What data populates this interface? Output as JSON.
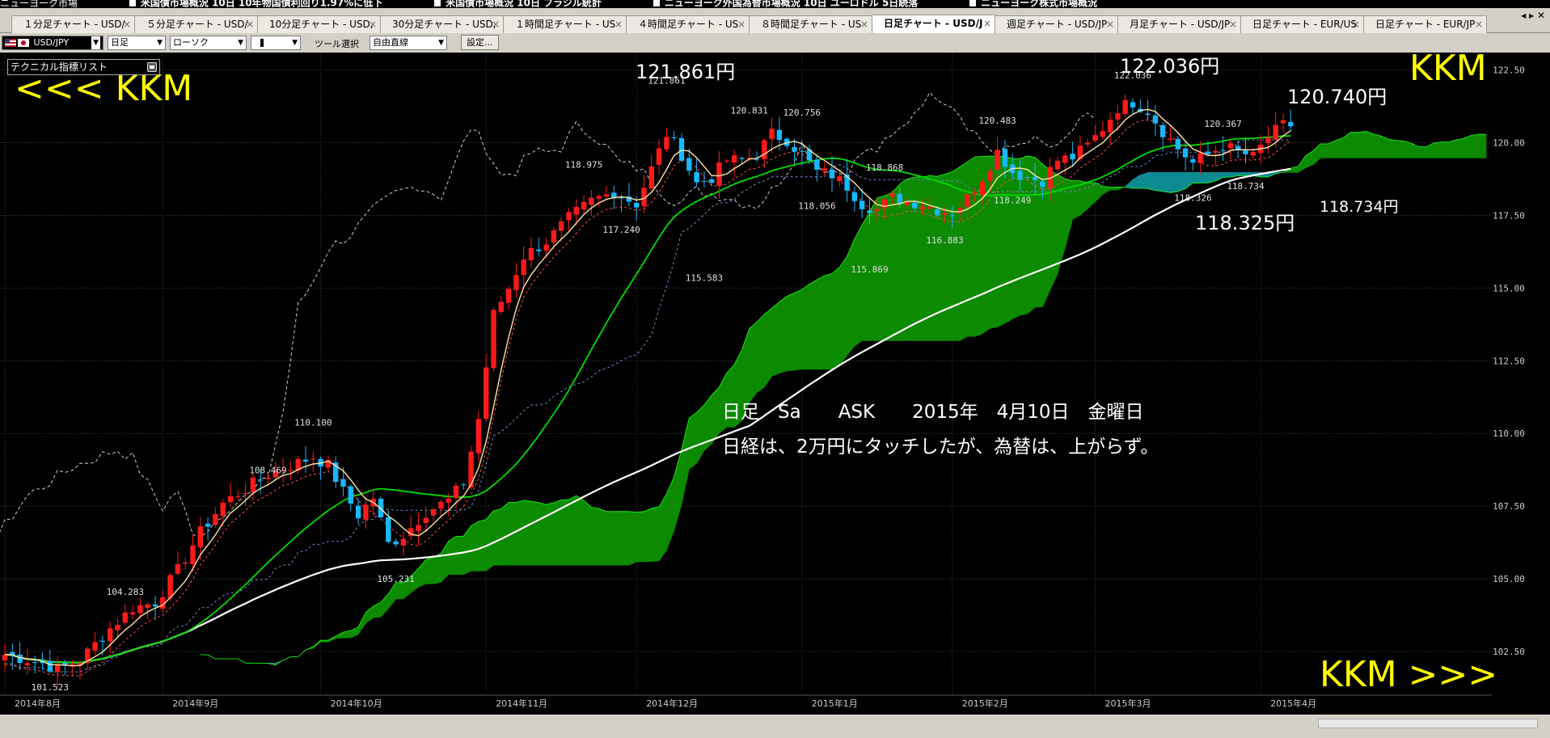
{
  "news_ticker": [
    "ニューヨーク市場",
    "米国債市場概況 10日 10年物国債利回り1.97%に低下",
    "米国債市場概況 10日 ブラジル統計",
    "ニューヨーク外国為替市場概況 10日 ユーロドル 5日続落",
    "ニューヨーク株式市場概況"
  ],
  "tabs": [
    {
      "label": "１分足チャート - USD/"
    },
    {
      "label": "５分足チャート - USD/"
    },
    {
      "label": "10分足チャート - USD,"
    },
    {
      "label": "30分足チャート - USD,"
    },
    {
      "label": "１時間足チャート - US"
    },
    {
      "label": "４時間足チャート - US"
    },
    {
      "label": "８時間足チャート - US"
    },
    {
      "label": "日足チャート - USD/J",
      "active": true
    },
    {
      "label": "週足チャート - USD/JP"
    },
    {
      "label": "月足チャート - USD/JP"
    },
    {
      "label": "日足チャート - EUR/US"
    },
    {
      "label": "日足チャート - EUR/JP"
    }
  ],
  "tab_controls": "◂ ▸ ✕",
  "toolbar": {
    "pair": "USD/JPY",
    "period": "日足",
    "chart_type": "ローソク",
    "tool_label": "ツール選択",
    "tool_value": "自由直線",
    "settings_button": "設定..."
  },
  "tech_list_label": "テクニカル指標リスト",
  "chart_data": {
    "type": "candlestick",
    "ylim": [
      101.0,
      123.1
    ],
    "y_ticks": [
      122.5,
      120.0,
      117.5,
      115.0,
      112.5,
      110.0,
      107.5,
      105.0,
      102.5
    ],
    "y_tick_labels": [
      "122.50",
      "120.00",
      "117.50",
      "115.00",
      "112.50",
      "110.00",
      "107.50",
      "105.00",
      "102.50"
    ],
    "x_labels": [
      {
        "label": "2014年8月",
        "index": 0
      },
      {
        "label": "2014年9月",
        "index": 21
      },
      {
        "label": "2014年10月",
        "index": 42
      },
      {
        "label": "2014年11月",
        "index": 64
      },
      {
        "label": "2014年12月",
        "index": 84
      },
      {
        "label": "2015年1月",
        "index": 106
      },
      {
        "label": "2015年2月",
        "index": 126
      },
      {
        "label": "2015年3月",
        "index": 145
      },
      {
        "label": "2015年4月",
        "index": 167
      }
    ],
    "price_labels": [
      {
        "text": "101.523",
        "index": 6,
        "value": 101.5,
        "pos": "below"
      },
      {
        "text": "104.283",
        "index": 16,
        "value": 104.28,
        "pos": "above"
      },
      {
        "text": "108.469",
        "index": 35,
        "value": 108.47,
        "pos": "above"
      },
      {
        "text": "110.100",
        "index": 41,
        "value": 110.1,
        "pos": "above"
      },
      {
        "text": "105.231",
        "index": 52,
        "value": 105.23,
        "pos": "below"
      },
      {
        "text": "118.975",
        "index": 77,
        "value": 118.97,
        "pos": "above"
      },
      {
        "text": "117.240",
        "index": 82,
        "value": 117.24,
        "pos": "below"
      },
      {
        "text": "121.861",
        "index": 88,
        "value": 121.86,
        "pos": "above"
      },
      {
        "text": "115.583",
        "index": 93,
        "value": 115.58,
        "pos": "below"
      },
      {
        "text": "120.831",
        "index": 99,
        "value": 120.83,
        "pos": "above"
      },
      {
        "text": "120.756",
        "index": 106,
        "value": 120.76,
        "pos": "above"
      },
      {
        "text": "118.056",
        "index": 108,
        "value": 118.06,
        "pos": "below"
      },
      {
        "text": "118.868",
        "index": 117,
        "value": 118.87,
        "pos": "above"
      },
      {
        "text": "115.869",
        "index": 115,
        "value": 115.87,
        "pos": "below"
      },
      {
        "text": "116.883",
        "index": 125,
        "value": 116.88,
        "pos": "below"
      },
      {
        "text": "120.483",
        "index": 132,
        "value": 120.48,
        "pos": "above"
      },
      {
        "text": "118.249",
        "index": 134,
        "value": 118.25,
        "pos": "below"
      },
      {
        "text": "122.036",
        "index": 150,
        "value": 122.04,
        "pos": "above"
      },
      {
        "text": "120.367",
        "index": 162,
        "value": 120.37,
        "pos": "above"
      },
      {
        "text": "118.326",
        "index": 158,
        "value": 118.33,
        "pos": "below"
      },
      {
        "text": "118.734",
        "index": 165,
        "value": 118.73,
        "pos": "below"
      }
    ],
    "close_path": [
      [
        0,
        102.4
      ],
      [
        5,
        102.1
      ],
      [
        7,
        101.9
      ],
      [
        10,
        102.2
      ],
      [
        14,
        103.3
      ],
      [
        17,
        104.0
      ],
      [
        20,
        104.2
      ],
      [
        23,
        105.3
      ],
      [
        26,
        106.6
      ],
      [
        29,
        107.6
      ],
      [
        32,
        108.1
      ],
      [
        35,
        108.6
      ],
      [
        38,
        108.9
      ],
      [
        41,
        109.2
      ],
      [
        43,
        108.9
      ],
      [
        45,
        108.0
      ],
      [
        47,
        107.2
      ],
      [
        49,
        107.8
      ],
      [
        51,
        106.2
      ],
      [
        53,
        106.5
      ],
      [
        56,
        107.3
      ],
      [
        59,
        107.7
      ],
      [
        61,
        108.3
      ],
      [
        63,
        110.5
      ],
      [
        65,
        114.1
      ],
      [
        67,
        115.0
      ],
      [
        69,
        116.1
      ],
      [
        72,
        116.6
      ],
      [
        75,
        117.4
      ],
      [
        78,
        118.0
      ],
      [
        81,
        118.3
      ],
      [
        84,
        117.9
      ],
      [
        86,
        119.1
      ],
      [
        88,
        120.3
      ],
      [
        90,
        119.6
      ],
      [
        92,
        118.6
      ],
      [
        94,
        118.8
      ],
      [
        96,
        119.4
      ],
      [
        98,
        119.4
      ],
      [
        100,
        119.6
      ],
      [
        102,
        120.3
      ],
      [
        104,
        120.1
      ],
      [
        106,
        119.6
      ],
      [
        108,
        119.0
      ],
      [
        110,
        118.9
      ],
      [
        112,
        118.5
      ],
      [
        114,
        117.9
      ],
      [
        116,
        117.7
      ],
      [
        118,
        118.1
      ],
      [
        120,
        118.0
      ],
      [
        122,
        117.9
      ],
      [
        124,
        117.7
      ],
      [
        126,
        117.6
      ],
      [
        128,
        118.1
      ],
      [
        130,
        118.8
      ],
      [
        132,
        119.7
      ],
      [
        134,
        119.0
      ],
      [
        136,
        118.8
      ],
      [
        138,
        118.7
      ],
      [
        140,
        119.4
      ],
      [
        142,
        119.5
      ],
      [
        144,
        119.9
      ],
      [
        146,
        120.5
      ],
      [
        148,
        121.2
      ],
      [
        150,
        121.4
      ],
      [
        152,
        121.1
      ],
      [
        154,
        120.4
      ],
      [
        156,
        119.8
      ],
      [
        158,
        119.3
      ],
      [
        160,
        119.6
      ],
      [
        162,
        119.9
      ],
      [
        164,
        119.7
      ],
      [
        166,
        119.5
      ],
      [
        168,
        120.2
      ],
      [
        170,
        120.6
      ]
    ],
    "annotations": {
      "high_1": "121.861円",
      "high_2": "122.036円",
      "current": "120.740円",
      "low_1": "118.734円",
      "low_2": "118.325円",
      "kkm_left": "<<< KKM",
      "kkm_right": "KKM",
      "kkm_bottom": "KKM >>>",
      "info_line1": "日足　Sa　　ASK　　2015年　4月10日　金曜日",
      "info_line2": "日経は、2万円にタッチしたが、為替は、上がらず。"
    },
    "colors": {
      "up": "#ff1a1a",
      "down": "#18b8ff",
      "kumo": "#0c8a00",
      "kumo_alt": "#0e8a92",
      "sma_short": "#ffe4a0",
      "sma_mid": "#00dd00",
      "sma_long": "#ffffff",
      "chikou": "#cccccc",
      "annotation_yellow": "#ffff00"
    }
  }
}
